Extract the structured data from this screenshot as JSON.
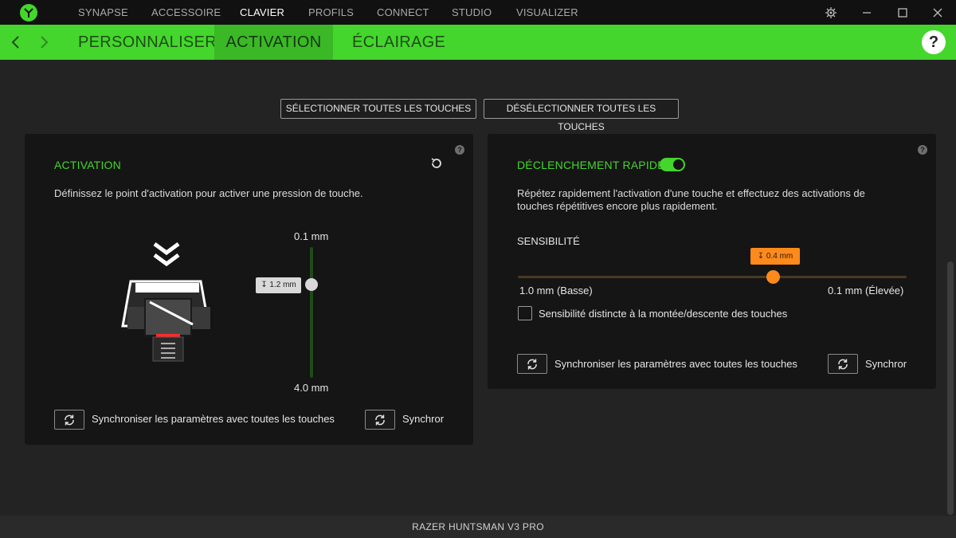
{
  "topnav": {
    "items": [
      "SYNAPSE",
      "ACCESSOIRE",
      "CLAVIER",
      "PROFILS",
      "CONNECT",
      "STUDIO",
      "VISUALIZER"
    ],
    "active": "CLAVIER"
  },
  "subnav": {
    "tabs": [
      "PERSONNALISER",
      "ACTIVATION",
      "ÉCLAIRAGE"
    ],
    "active": "ACTIVATION",
    "help_label": "?"
  },
  "actions": {
    "select_all": "SÉLECTIONNER TOUTES LES TOUCHES",
    "deselect_all": "DÉSÉLECTIONNER TOUTES LES TOUCHES"
  },
  "activation_panel": {
    "title": "ACTIVATION",
    "description": "Définissez le point d'activation pour activer une pression de touche.",
    "slider_top_label": "0.1 mm",
    "slider_bottom_label": "4.0 mm",
    "slider_value_label": "1.2 mm",
    "sync_all_label": "Synchroniser les paramètres avec toutes les touches",
    "sync_partial_label": "Synchror"
  },
  "rapid_panel": {
    "title": "DÉCLENCHEMENT RAPIDE",
    "toggle_on": true,
    "description_line1": "Répétez rapidement l'activation d'une touche et effectuez des activations de",
    "description_line2": "touches répétitives encore plus rapidement.",
    "sensitivity_label": "SENSIBILITÉ",
    "slider_value_label": "0.4 mm",
    "slider_min_label": "1.0 mm (Basse)",
    "slider_max_label": "0.1 mm (Élevée)",
    "checkbox_label": "Sensibilité distincte à la montée/descente des touches",
    "sync_all_label": "Synchroniser les paramètres avec toutes les touches",
    "sync_partial_label": "Synchror"
  },
  "footer": {
    "device_name": "RAZER HUNTSMAN V3 PRO"
  },
  "colors": {
    "accent_green": "#44d62c",
    "slider_orange": "#ff8a1c"
  }
}
